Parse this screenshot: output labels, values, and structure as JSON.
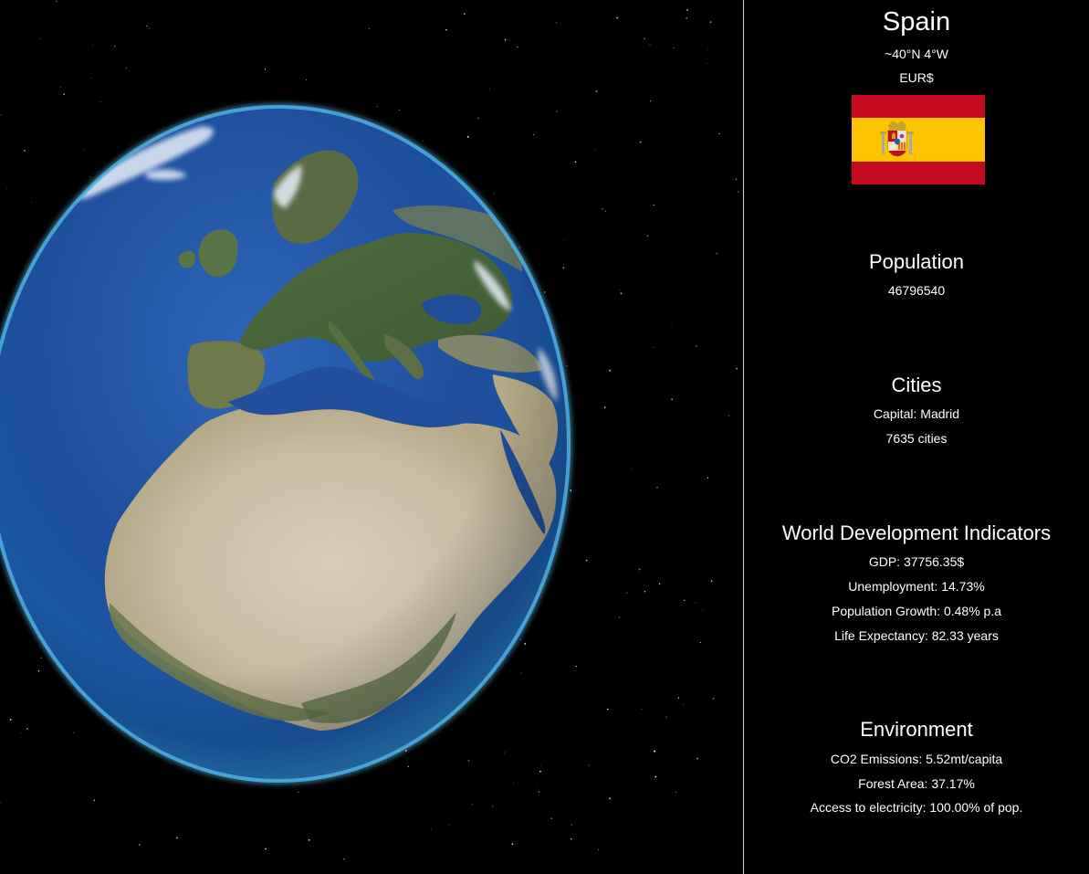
{
  "globe": {
    "region_shown": "Europe and North Africa",
    "ocean_color": "#1d4f9a",
    "atmosphere_color": "#4fb4e8"
  },
  "country": {
    "name": "Spain",
    "coordinates": "~40°N 4°W",
    "currency": "EUR$",
    "flag": {
      "stripe_red": "#c60b1e",
      "stripe_yellow": "#ffc400",
      "emblem": "coat-of-arms"
    }
  },
  "population": {
    "heading": "Population",
    "value": "46796540"
  },
  "cities": {
    "heading": "Cities",
    "capital": "Capital: Madrid",
    "count": "7635 cities"
  },
  "wdi": {
    "heading": "World Development Indicators",
    "gdp": "GDP: 37756.35$",
    "unemployment": "Unemployment: 14.73%",
    "population_growth": "Population Growth: 0.48% p.a",
    "life_expectancy": "Life Expectancy: 82.33 years"
  },
  "environment": {
    "heading": "Environment",
    "co2": "CO2 Emissions: 5.52mt/capita",
    "forest": "Forest Area: 37.17%",
    "electricity": "Access to electricity: 100.00% of pop."
  }
}
